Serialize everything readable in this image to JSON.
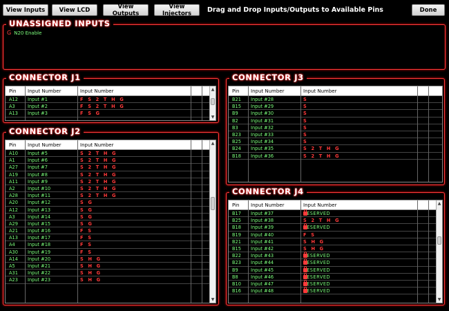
{
  "toolbar": {
    "view_inputs": "View Inputs",
    "view_lcd": "View LCD",
    "view_outputs": "View Outputs",
    "view_injectors": "View Injectors",
    "title": "Drag and Drop Inputs/Outputs to Available Pins",
    "done": "Done"
  },
  "unassigned": {
    "title": "UNASSIGNED INPUTS",
    "item_code": "G",
    "item_label": "N20 Enable"
  },
  "headers": {
    "pin": "Pin",
    "input_number": "Input Number",
    "functions": "Input Number"
  },
  "j1": {
    "title": "CONNECTOR J1",
    "rows": [
      {
        "pin": "A12",
        "input": "Input #1",
        "codes": "F S 2 T H G"
      },
      {
        "pin": "A3",
        "input": "Input #2",
        "codes": "F S 2 T H G"
      },
      {
        "pin": "A13",
        "input": "Input #3",
        "codes": "F S G"
      }
    ]
  },
  "j2": {
    "title": "CONNECTOR J2",
    "rows": [
      {
        "pin": "A10",
        "input": "Input #5",
        "codes": "S 2 T H G"
      },
      {
        "pin": "A1",
        "input": "Input #6",
        "codes": "S 2 T H G"
      },
      {
        "pin": "A27",
        "input": "Input #7",
        "codes": "S 2 T H G"
      },
      {
        "pin": "A19",
        "input": "Input #8",
        "codes": "S 2 T H G"
      },
      {
        "pin": "A11",
        "input": "Input #9",
        "codes": "S 2 T H G"
      },
      {
        "pin": "A2",
        "input": "Input #10",
        "codes": "S 2 T H G"
      },
      {
        "pin": "A28",
        "input": "Input #11",
        "codes": "S 2 T H G"
      },
      {
        "pin": "A20",
        "input": "Input #12",
        "codes": "S G"
      },
      {
        "pin": "A12",
        "input": "Input #13",
        "codes": "S G"
      },
      {
        "pin": "A3",
        "input": "Input #14",
        "codes": "S G"
      },
      {
        "pin": "A29",
        "input": "Input #15",
        "codes": "S G"
      },
      {
        "pin": "A21",
        "input": "Input #16",
        "codes": "F S"
      },
      {
        "pin": "A13",
        "input": "Input #17",
        "codes": "F S"
      },
      {
        "pin": "A4",
        "input": "Input #18",
        "codes": "F S"
      },
      {
        "pin": "A30",
        "input": "Input #19",
        "codes": "F S"
      },
      {
        "pin": "A14",
        "input": "Input #20",
        "codes": "S H G"
      },
      {
        "pin": "A5",
        "input": "Input #21",
        "codes": "S H G"
      },
      {
        "pin": "A31",
        "input": "Input #22",
        "codes": "S H G"
      },
      {
        "pin": "A23",
        "input": "Input #23",
        "codes": "S H G"
      }
    ]
  },
  "j3": {
    "title": "CONNECTOR J3",
    "rows": [
      {
        "pin": "B21",
        "input": "Input #28",
        "codes": "S"
      },
      {
        "pin": "B15",
        "input": "Input #29",
        "codes": "S"
      },
      {
        "pin": "B9",
        "input": "Input #30",
        "codes": "S"
      },
      {
        "pin": "B2",
        "input": "Input #31",
        "codes": "S"
      },
      {
        "pin": "B3",
        "input": "Input #32",
        "codes": "S"
      },
      {
        "pin": "B23",
        "input": "Input #33",
        "codes": "S"
      },
      {
        "pin": "B25",
        "input": "Input #34",
        "codes": "S"
      },
      {
        "pin": "B24",
        "input": "Input #35",
        "codes": "S 2 T H G"
      },
      {
        "pin": "B18",
        "input": "Input #36",
        "codes": "S 2 T H G"
      }
    ]
  },
  "j4": {
    "title": "CONNECTOR J4",
    "rows": [
      {
        "pin": "B17",
        "input": "Input #37",
        "codes": "",
        "reserved": "RESERVED"
      },
      {
        "pin": "B25",
        "input": "Input #38",
        "codes": "S 2 T H G",
        "reserved": ""
      },
      {
        "pin": "B18",
        "input": "Input #39",
        "codes": "",
        "reserved": "RESERVED"
      },
      {
        "pin": "B19",
        "input": "Input #40",
        "codes": "F S",
        "reserved": ""
      },
      {
        "pin": "B21",
        "input": "Input #41",
        "codes": "S H G",
        "reserved": ""
      },
      {
        "pin": "B15",
        "input": "Input #42",
        "codes": "S H G",
        "reserved": ""
      },
      {
        "pin": "B22",
        "input": "Input #43",
        "codes": "",
        "reserved": "RESERVED"
      },
      {
        "pin": "B23",
        "input": "Input #44",
        "codes": "",
        "reserved": "RESERVED"
      },
      {
        "pin": "B9",
        "input": "Input #45",
        "codes": "",
        "reserved": "RESERVED"
      },
      {
        "pin": "B8",
        "input": "Input #46",
        "codes": "",
        "reserved": "RESERVED"
      },
      {
        "pin": "B10",
        "input": "Input #47",
        "codes": "",
        "reserved": "RESERVED"
      },
      {
        "pin": "B16",
        "input": "Input #48",
        "codes": "",
        "reserved": "RESERVED"
      }
    ]
  },
  "colors": {
    "accent_red": "#ff3a3a",
    "text_green": "#7dff7d",
    "background": "#000000"
  }
}
